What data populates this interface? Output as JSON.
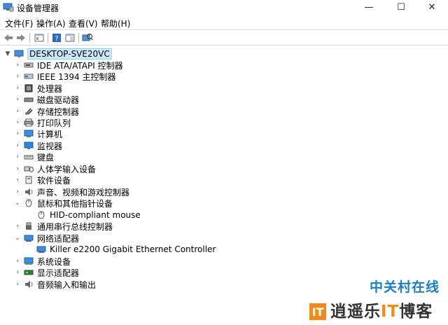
{
  "window": {
    "title": "设备管理器",
    "controls": {
      "minimize": "—",
      "maximize": "☐",
      "close": "✕"
    }
  },
  "menu": [
    "文件(F)",
    "操作(A)",
    "查看(V)",
    "帮助(H)"
  ],
  "toolbar": [
    "back-arrow-icon",
    "forward-arrow-icon",
    "properties-icon",
    "help-icon",
    "panel-icon",
    "scan-hardware-icon"
  ],
  "tree": {
    "root": "DESKTOP-SVE20VC",
    "categories": [
      {
        "label": "IDE ATA/ATAPI 控制器",
        "icon": "ide-controller-icon",
        "expanded": false
      },
      {
        "label": "IEEE 1394 主控制器",
        "icon": "ieee1394-icon",
        "expanded": false
      },
      {
        "label": "处理器",
        "icon": "processor-icon",
        "expanded": false
      },
      {
        "label": "磁盘驱动器",
        "icon": "disk-drive-icon",
        "expanded": false
      },
      {
        "label": "存储控制器",
        "icon": "storage-controller-icon",
        "expanded": false
      },
      {
        "label": "打印队列",
        "icon": "printer-icon",
        "expanded": false
      },
      {
        "label": "计算机",
        "icon": "computer-icon",
        "expanded": false
      },
      {
        "label": "监视器",
        "icon": "monitor-icon",
        "expanded": false
      },
      {
        "label": "键盘",
        "icon": "keyboard-icon",
        "expanded": false
      },
      {
        "label": "人体学输入设备",
        "icon": "hid-icon",
        "expanded": false
      },
      {
        "label": "软件设备",
        "icon": "software-device-icon",
        "expanded": false
      },
      {
        "label": "声音、视频和游戏控制器",
        "icon": "sound-icon",
        "expanded": false
      },
      {
        "label": "鼠标和其他指针设备",
        "icon": "mouse-icon",
        "expanded": true,
        "children": [
          "HID-compliant mouse"
        ]
      },
      {
        "label": "通用串行总线控制器",
        "icon": "usb-icon",
        "expanded": false
      },
      {
        "label": "网络适配器",
        "icon": "network-adapter-icon",
        "expanded": true,
        "children": [
          "Killer e2200 Gigabit Ethernet Controller"
        ]
      },
      {
        "label": "系统设备",
        "icon": "system-device-icon",
        "expanded": false
      },
      {
        "label": "显示适配器",
        "icon": "display-adapter-icon",
        "expanded": false
      },
      {
        "label": "音频输入和输出",
        "icon": "audio-io-icon",
        "expanded": false
      }
    ]
  },
  "watermark": {
    "line1": "中关村在线",
    "logo": "IT",
    "line2_a": "逍遥乐",
    "line2_b": "IT",
    "line2_c": "博客"
  },
  "colors": {
    "selection": "#cce8ff",
    "accent": "#1b7dc4",
    "watermark_orange": "#f08a1b"
  }
}
